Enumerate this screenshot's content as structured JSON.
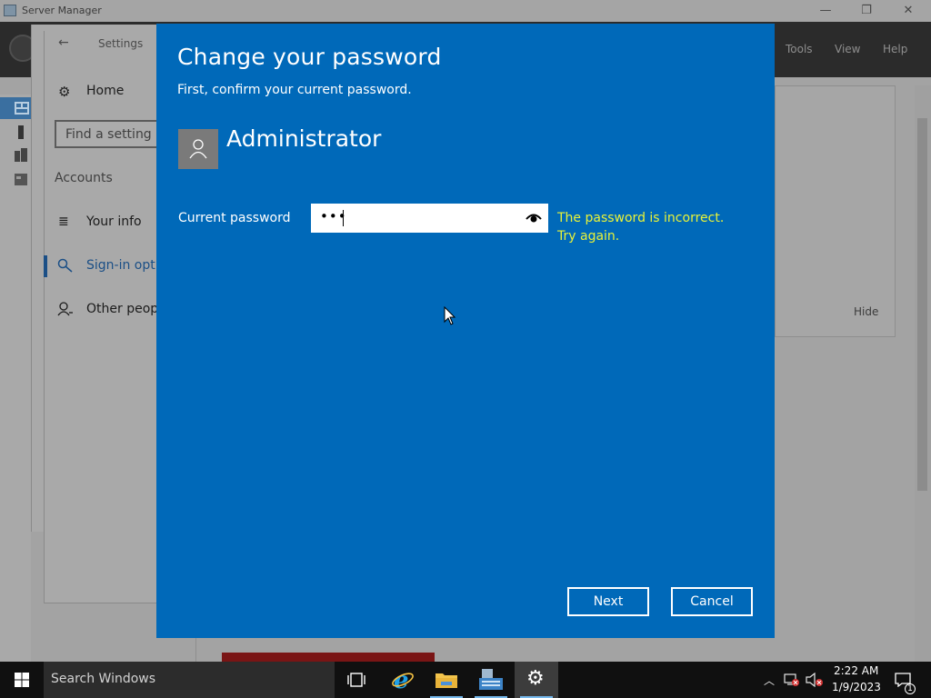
{
  "server_manager": {
    "title": "Server Manager",
    "menu": {
      "tools": "Tools",
      "view": "View",
      "help": "Help"
    },
    "panel_hide": "Hide",
    "window_controls": {
      "minimize": "—",
      "restore": "❐",
      "close": "✕"
    }
  },
  "settings": {
    "title": "Settings",
    "back_icon": "arrow-left-icon",
    "home": "Home",
    "search_placeholder": "Find a setting",
    "section": "Accounts",
    "items": [
      {
        "label": "Your info",
        "icon": "person-card-icon"
      },
      {
        "label": "Sign-in options",
        "icon": "key-icon",
        "selected": true
      },
      {
        "label": "Other people",
        "icon": "person-add-icon"
      }
    ]
  },
  "dialog": {
    "title": "Change your password",
    "subtitle": "First, confirm your current password.",
    "username": "Administrator",
    "password_label": "Current password",
    "password_value": "•••",
    "error_line1": "The password is incorrect.",
    "error_line2": "Try again.",
    "next_label": "Next",
    "cancel_label": "Cancel",
    "colors": {
      "background": "#0069b9",
      "error_text": "#e8f238"
    }
  },
  "taskbar": {
    "search_placeholder": "Search Windows",
    "apps": [
      "task-view-icon",
      "internet-explorer-icon",
      "file-explorer-icon",
      "server-manager-icon",
      "settings-gear-icon"
    ],
    "time": "2:22 AM",
    "date": "1/9/2023",
    "notification_count": "1"
  }
}
